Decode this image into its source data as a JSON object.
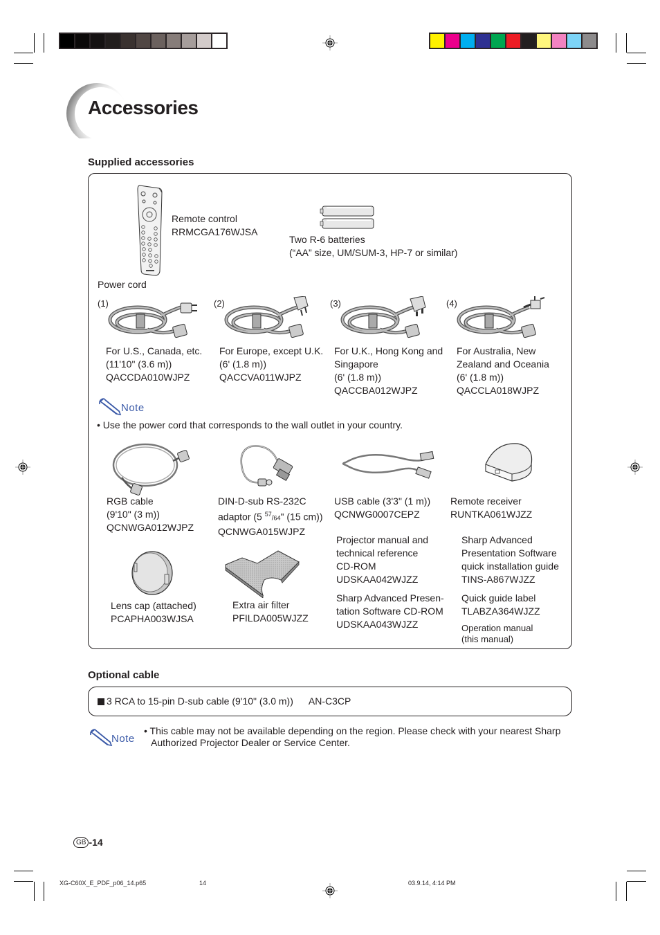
{
  "print_marks": {
    "gray_swatches": [
      "#000000",
      "#0b0909",
      "#151212",
      "#221e1d",
      "#3a3230",
      "#514744",
      "#6b615e",
      "#877d7a",
      "#a69d9b",
      "#d3cbca",
      "#ffffff"
    ],
    "color_swatches": [
      "#fff100",
      "#ec008c",
      "#00aeef",
      "#2e3192",
      "#00a651",
      "#ed1c24",
      "#231f20",
      "#fff67d",
      "#f383c1",
      "#7dd4f7",
      "#8d8b8c"
    ]
  },
  "page": {
    "title": "Accessories",
    "supplied_heading": "Supplied accessories",
    "optional_heading": "Optional cable"
  },
  "supplied": {
    "remote": {
      "name": "Remote control",
      "part": "RRMCGA176WJSA"
    },
    "batteries": {
      "name": "Two R-6 batteries",
      "detail": "(“AA” size, UM/SUM-3, HP-7 or similar)"
    },
    "power_cord_label": "Power cord",
    "power_cords": [
      {
        "num": "(1)",
        "lines": [
          "For U.S., Canada, etc.",
          "(11'10\" (3.6 m))",
          "QACCDA010WJPZ"
        ]
      },
      {
        "num": "(2)",
        "lines": [
          "For Europe, except U.K.",
          "(6' (1.8 m))",
          "QACCVA011WJPZ"
        ]
      },
      {
        "num": "(3)",
        "lines": [
          "For U.K., Hong Kong and",
          "Singapore",
          "(6' (1.8 m))",
          "QACCBA012WJPZ"
        ]
      },
      {
        "num": "(4)",
        "lines": [
          "For Australia, New",
          "Zealand and Oceania",
          "(6' (1.8 m))",
          "QACCLA018WJPZ"
        ]
      }
    ],
    "note_label": "Note",
    "note_text": "Use the power cord that corresponds to the wall outlet in your country.",
    "row2": [
      {
        "lines": [
          "RGB cable",
          "(9'10\" (3 m))",
          "QCNWGA012WJPZ"
        ]
      },
      {
        "line1": "DIN-D-sub RS-232C",
        "line2_pre": "adaptor (5 ",
        "sup": "57",
        "frac_sep": "/",
        "sub": "64",
        "line2_post": "\" (15 cm))",
        "line3": "QCNWGA015WJPZ"
      },
      {
        "lines": [
          "USB cable (3'3\" (1 m))",
          "QCNWG0007CEPZ"
        ]
      },
      {
        "lines": [
          "Remote receiver",
          "RUNTKA061WJZZ"
        ]
      }
    ],
    "lens_cap": {
      "name": "Lens cap (attached)",
      "part": "PCAPHA003WJSA"
    },
    "air_filter": {
      "name": "Extra air filter",
      "part": "PFILDA005WJZZ"
    },
    "cd_manual": {
      "lines": [
        "Projector manual and",
        "technical reference",
        "CD-ROM",
        "UDSKAA042WJZZ"
      ]
    },
    "cd_software": {
      "lines": [
        "Sharp Advanced Presen-",
        "tation Software CD-ROM",
        "UDSKAA043WJZZ"
      ]
    },
    "quick_install": {
      "lines": [
        "Sharp Advanced",
        "Presentation Software",
        "quick installation guide",
        "TINS-A867WJZZ"
      ]
    },
    "quick_label": {
      "lines": [
        "Quick guide label",
        "TLABZA364WJZZ"
      ]
    },
    "operation_manual": {
      "lines": [
        "Operation manual",
        "(this manual)"
      ]
    }
  },
  "optional": {
    "item": "3 RCA to 15-pin D-sub cable (9'10\" (3.0 m))",
    "part": "AN-C3CP",
    "note_label": "Note",
    "note_text_1": "This cable may not be available depending on the region. Please check with your nearest Sharp",
    "note_text_2": "Authorized Projector Dealer or Service Center."
  },
  "footer": {
    "page_badge": "GB",
    "page_num": "-14",
    "file": "XG-C60X_E_PDF_p06_14.p65",
    "sheet": "14",
    "date": "03.9.14, 4:14 PM"
  }
}
